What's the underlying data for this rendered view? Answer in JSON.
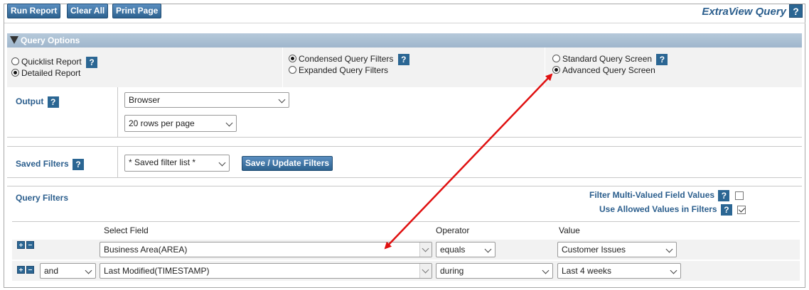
{
  "toolbar": {
    "run_report": "Run Report",
    "clear_all": "Clear All",
    "print_page": "Print Page"
  },
  "app_title": "ExtraView Query",
  "help_glyph": "?",
  "query_options": {
    "header": "Query Options",
    "report_types": [
      {
        "label": "Quicklist Report",
        "selected": false
      },
      {
        "label": "Detailed Report",
        "selected": true
      }
    ],
    "filter_modes": [
      {
        "label": "Condensed Query Filters",
        "selected": true
      },
      {
        "label": "Expanded Query Filters",
        "selected": false
      }
    ],
    "screen_modes": [
      {
        "label": "Standard Query Screen",
        "selected": false
      },
      {
        "label": "Advanced Query Screen",
        "selected": true
      }
    ]
  },
  "output": {
    "label": "Output",
    "format_value": "Browser",
    "rows_value": "20 rows per page"
  },
  "saved_filters": {
    "label": "Saved Filters",
    "select_value": "* Saved filter list *",
    "save_button": "Save / Update Filters"
  },
  "query_filters": {
    "title": "Query Filters",
    "multi_valued_label": "Filter Multi-Valued Field Values",
    "multi_valued_checked": false,
    "allowed_values_label": "Use Allowed Values in Filters",
    "allowed_values_checked": true,
    "columns": {
      "select_field": "Select Field",
      "operator": "Operator",
      "value": "Value"
    },
    "rows": [
      {
        "conjunction": "",
        "field": "Business Area(AREA)",
        "operator": "equals",
        "value": "Customer Issues"
      },
      {
        "conjunction": "and",
        "field": "Last Modified(TIMESTAMP)",
        "operator": "during",
        "value": "Last 4 weeks"
      }
    ]
  },
  "colors": {
    "accent": "#2b6693",
    "header_band": "#9fb6cc",
    "label_blue": "#2b5e8d",
    "annotation_arrow": "#e01010"
  }
}
